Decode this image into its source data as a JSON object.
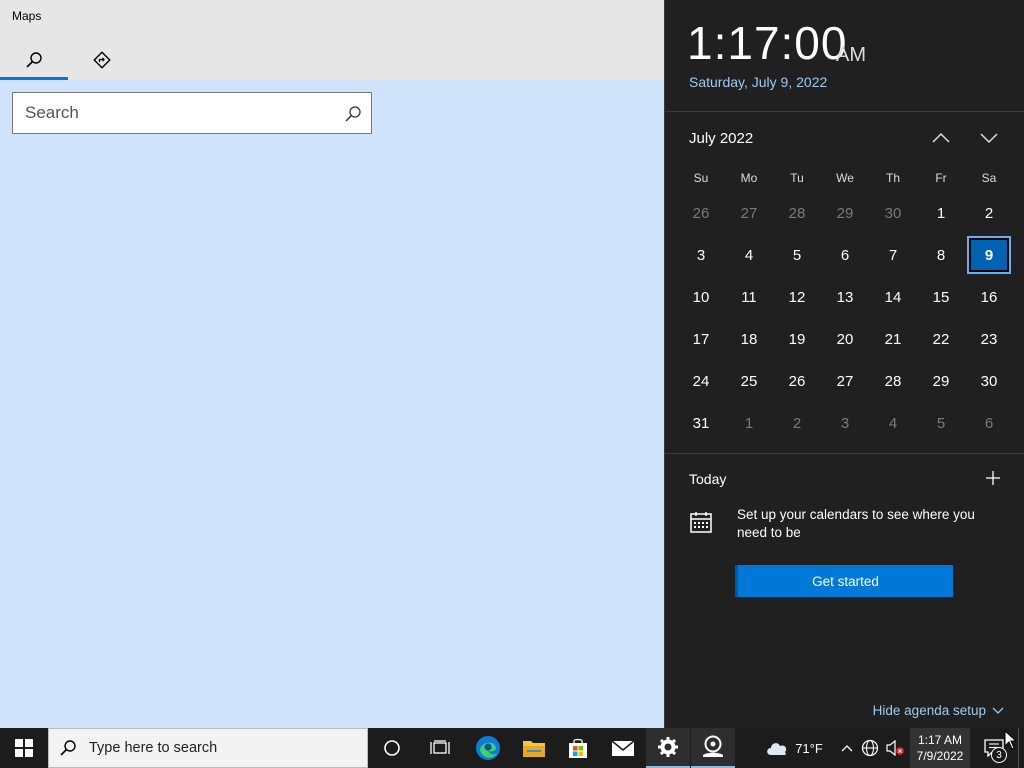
{
  "maps": {
    "title": "Maps",
    "tabs": [
      {
        "icon": "search-icon",
        "selected": true
      },
      {
        "icon": "directions-icon",
        "selected": false
      }
    ],
    "search": {
      "placeholder": "Search",
      "value": ""
    }
  },
  "flyout": {
    "time": "1:17:00",
    "ampm": "AM",
    "long_date": "Saturday, July 9, 2022",
    "month_label": "July 2022",
    "day_headers": [
      "Su",
      "Mo",
      "Tu",
      "We",
      "Th",
      "Fr",
      "Sa"
    ],
    "weeks": [
      [
        {
          "d": "26",
          "o": true
        },
        {
          "d": "27",
          "o": true
        },
        {
          "d": "28",
          "o": true
        },
        {
          "d": "29",
          "o": true
        },
        {
          "d": "30",
          "o": true
        },
        {
          "d": "1"
        },
        {
          "d": "2"
        }
      ],
      [
        {
          "d": "3"
        },
        {
          "d": "4"
        },
        {
          "d": "5"
        },
        {
          "d": "6"
        },
        {
          "d": "7"
        },
        {
          "d": "8"
        },
        {
          "d": "9",
          "today": true
        }
      ],
      [
        {
          "d": "10"
        },
        {
          "d": "11"
        },
        {
          "d": "12"
        },
        {
          "d": "13"
        },
        {
          "d": "14"
        },
        {
          "d": "15"
        },
        {
          "d": "16"
        }
      ],
      [
        {
          "d": "17"
        },
        {
          "d": "18"
        },
        {
          "d": "19"
        },
        {
          "d": "20"
        },
        {
          "d": "21"
        },
        {
          "d": "22"
        },
        {
          "d": "23"
        }
      ],
      [
        {
          "d": "24"
        },
        {
          "d": "25"
        },
        {
          "d": "26"
        },
        {
          "d": "27"
        },
        {
          "d": "28"
        },
        {
          "d": "29"
        },
        {
          "d": "30"
        }
      ],
      [
        {
          "d": "31"
        },
        {
          "d": "1",
          "o": true
        },
        {
          "d": "2",
          "o": true
        },
        {
          "d": "3",
          "o": true
        },
        {
          "d": "4",
          "o": true
        },
        {
          "d": "5",
          "o": true
        },
        {
          "d": "6",
          "o": true
        }
      ]
    ],
    "today_label": "Today",
    "agenda_message": "Set up your calendars to see where you need to be",
    "get_started_label": "Get started",
    "hide_agenda_label": "Hide agenda setup"
  },
  "taskbar": {
    "search_placeholder": "Type here to search",
    "weather_temp": "71°F",
    "clock_time": "1:17 AM",
    "clock_date": "7/9/2022",
    "notification_count": "3"
  },
  "colors": {
    "accent": "#0078d7",
    "flyout_bg": "#202020",
    "map_bg": "#cfe4fa",
    "link": "#9ecbf2"
  }
}
